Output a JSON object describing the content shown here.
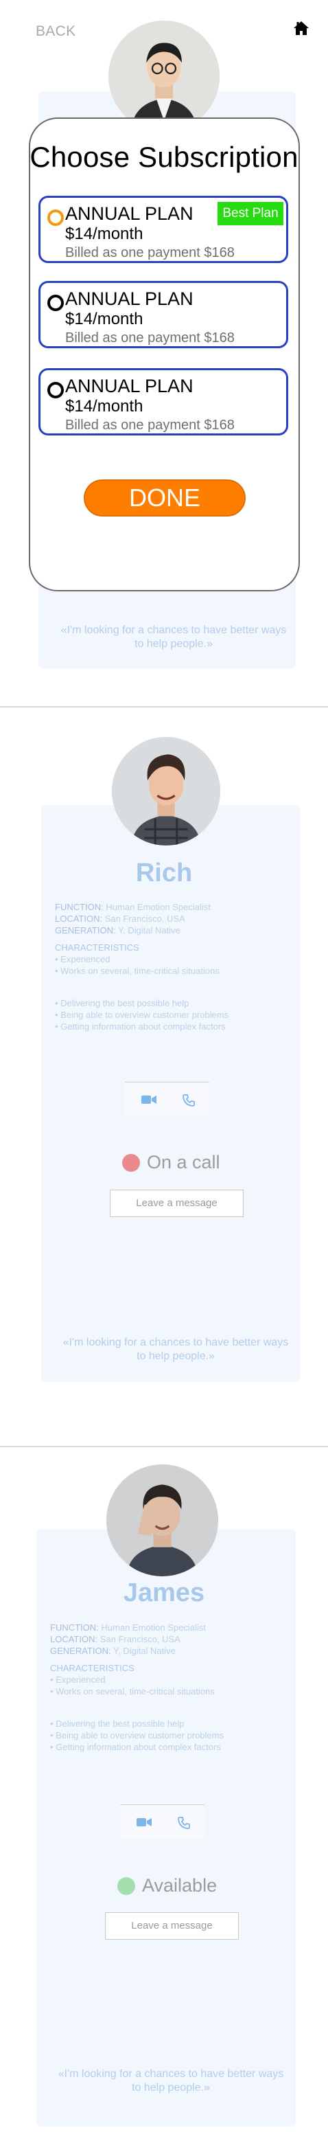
{
  "topbar": {
    "back_label": "BACK",
    "home_icon": "home-icon"
  },
  "profiles": [
    {
      "name": "Rich",
      "function_label": "FUNCTION:",
      "function_value": "Human Emotion Specialist",
      "location_label": "LOCATION:",
      "location_value": "San Francisco, USA",
      "generation_label": "GENERATION:",
      "generation_value": "Y, Digital Native",
      "characteristics_label": "CHARACTERISTICS",
      "characteristics": [
        "• Experienced",
        "• Works on several, time-critical situations"
      ],
      "goals": [
        "• Delivering the best possible help",
        "• Being able to overview customer problems",
        "• Getting information about complex factors"
      ],
      "status": "On a call",
      "status_color": "#ea8a8f",
      "message_button": "Leave a message",
      "quote": "«I'm looking for a chances to have better ways to help people.»"
    },
    {
      "name": "James",
      "function_label": "FUNCTION:",
      "function_value": "Human Emotion Specialist",
      "location_label": "LOCATION:",
      "location_value": "San Francisco, USA",
      "generation_label": "GENERATION:",
      "generation_value": "Y, Digital Native",
      "characteristics_label": "CHARACTERISTICS",
      "characteristics": [
        "• Experienced",
        "• Works on several, time-critical situations"
      ],
      "goals": [
        "• Delivering the best possible help",
        "• Being able to overview customer problems",
        "• Getting information about complex factors"
      ],
      "status": "Available",
      "status_color": "#a3dfac",
      "message_button": "Leave a message",
      "quote": "«I'm looking for a chances to have better ways to help people.»"
    }
  ],
  "top_profile": {
    "quote": "«I'm looking for a chances to have better ways to help people.»"
  },
  "modal": {
    "title": "Choose Subscription",
    "plans": [
      {
        "name": "ANNUAL PLAN",
        "price": "$14/month",
        "billing": "Billed as one payment $168",
        "badge": "Best Plan",
        "selected": true
      },
      {
        "name": "ANNUAL PLAN",
        "price": "$14/month",
        "billing": "Billed as one payment $168",
        "selected": false
      },
      {
        "name": "ANNUAL PLAN",
        "price": "$14/month",
        "billing": "Billed as one payment $168",
        "selected": false
      }
    ],
    "done_label": "DONE"
  },
  "colors": {
    "plan_border": "#2b3fc2",
    "best_badge": "#27db11",
    "done_button": "#ff7e00",
    "radio_selected": "#f29a0d"
  }
}
